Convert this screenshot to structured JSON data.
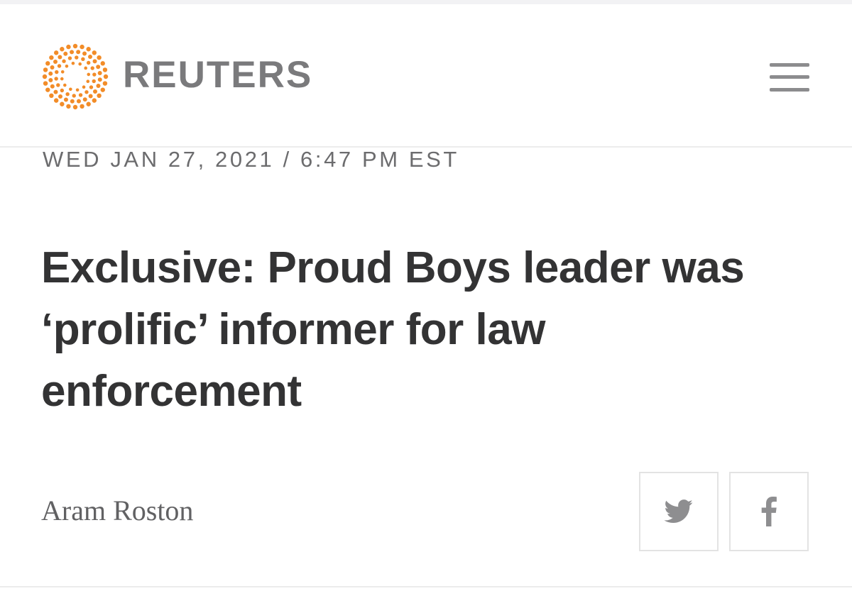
{
  "header": {
    "brand_name": "REUTERS",
    "logo_icon": "reuters-dot-ring-logo",
    "menu_icon": "hamburger-menu-icon",
    "accent_color": "#f28c28"
  },
  "article": {
    "dateline": "WED JAN 27, 2021 / 6:47 PM EST",
    "headline": "Exclusive: Proud Boys leader was ‘prolific’ informer for law enforcement",
    "byline": "Aram Roston"
  },
  "share": {
    "buttons": [
      {
        "network": "twitter",
        "icon": "twitter-bird-icon"
      },
      {
        "network": "facebook",
        "icon": "facebook-f-icon"
      }
    ],
    "icon_color": "#8e8e90"
  }
}
